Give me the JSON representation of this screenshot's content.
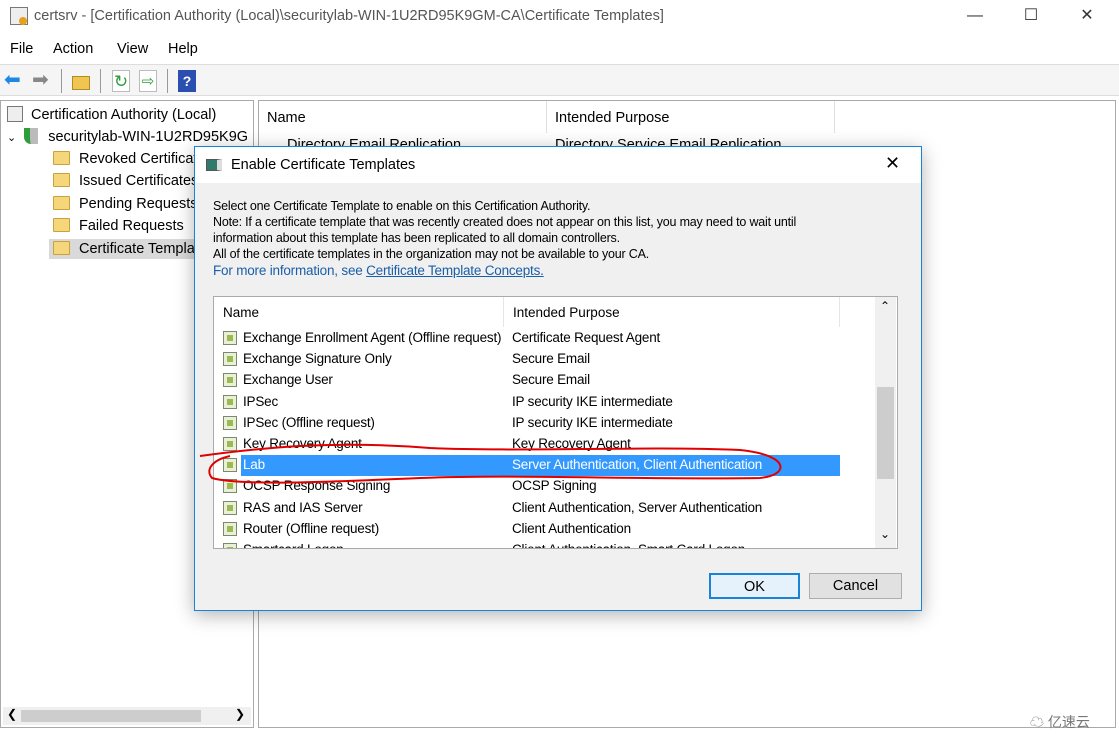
{
  "window": {
    "title": "certsrv - [Certification Authority (Local)\\securitylab-WIN-1U2RD95K9GM-CA\\Certificate Templates]",
    "controls": [
      "minimize",
      "maximize",
      "close"
    ]
  },
  "menu": [
    "File",
    "Action",
    "View",
    "Help"
  ],
  "toolbar": [
    "back-icon",
    "forward-icon",
    "up-folder-icon",
    "refresh-icon",
    "export-icon",
    "help-icon"
  ],
  "tree": {
    "root": "Certification Authority (Local)",
    "ca": "securitylab-WIN-1U2RD95K9G",
    "children": [
      "Revoked Certificates",
      "Issued Certificates",
      "Pending Requests",
      "Failed Requests",
      "Certificate Templates"
    ],
    "selected": "Certificate Templates"
  },
  "right": {
    "columns": [
      "Name",
      "Intended Purpose"
    ],
    "rows": [
      {
        "name": "Directory Email Replication",
        "purpose": "Directory Service Email Replication"
      }
    ]
  },
  "dialog": {
    "title": "Enable Certificate Templates",
    "lines": [
      "Select one Certificate Template to enable on this Certification Authority.",
      "Note: If a certificate template that was recently created does not appear on this list, you may need to wait until",
      "information about this template has been replicated to all domain controllers.",
      "All of the certificate templates in the organization may not be available to your CA."
    ],
    "info_prefix": "For more information, see ",
    "info_link": "Certificate Template Concepts.",
    "columns": [
      "Name",
      "Intended Purpose"
    ],
    "rows": [
      {
        "name": "Exchange Enrollment Agent (Offline request)",
        "purpose": "Certificate Request Agent"
      },
      {
        "name": "Exchange Signature Only",
        "purpose": "Secure Email"
      },
      {
        "name": "Exchange User",
        "purpose": "Secure Email"
      },
      {
        "name": "IPSec",
        "purpose": "IP security IKE intermediate"
      },
      {
        "name": "IPSec (Offline request)",
        "purpose": "IP security IKE intermediate"
      },
      {
        "name": "Key Recovery Agent",
        "purpose": "Key Recovery Agent"
      },
      {
        "name": "Lab",
        "purpose": "Server Authentication, Client Authentication",
        "selected": true
      },
      {
        "name": "OCSP Response Signing",
        "purpose": "OCSP Signing"
      },
      {
        "name": "RAS and IAS Server",
        "purpose": "Client Authentication, Server Authentication"
      },
      {
        "name": "Router (Offline request)",
        "purpose": "Client Authentication"
      },
      {
        "name": "Smartcard Logon",
        "purpose": "Client Authentication, Smart Card Logon"
      }
    ],
    "ok": "OK",
    "cancel": "Cancel"
  },
  "colors": {
    "selection": "#3399ff",
    "accent": "#1883d7",
    "link": "#1a5ea8",
    "annotation": "#e00000"
  },
  "watermark": "亿速云"
}
